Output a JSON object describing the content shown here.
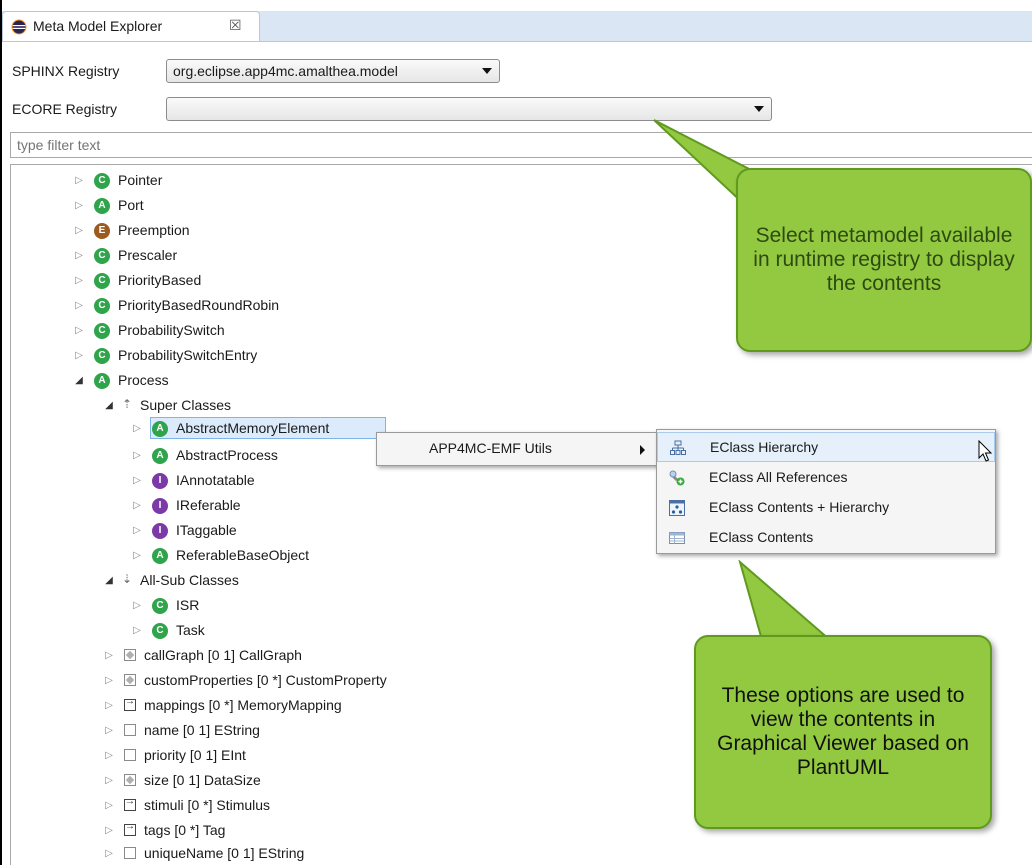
{
  "tab": {
    "title": "Meta Model Explorer",
    "close": "☒"
  },
  "sphinx": {
    "label": "SPHINX Registry",
    "value": "org.eclipse.app4mc.amalthea.model"
  },
  "ecore": {
    "label": "ECORE Registry",
    "value": ""
  },
  "filter": {
    "placeholder": "type filter text"
  },
  "tree": {
    "top_items": [
      {
        "kind": "C",
        "label": "Pointer"
      },
      {
        "kind": "A",
        "label": "Port"
      },
      {
        "kind": "E",
        "label": "Preemption"
      },
      {
        "kind": "C",
        "label": "Prescaler"
      },
      {
        "kind": "C",
        "label": "PriorityBased"
      },
      {
        "kind": "C",
        "label": "PriorityBasedRoundRobin"
      },
      {
        "kind": "C",
        "label": "ProbabilitySwitch"
      },
      {
        "kind": "C",
        "label": "ProbabilitySwitchEntry"
      },
      {
        "kind": "A",
        "label": "Process"
      }
    ],
    "super_group": "Super Classes",
    "super_items": [
      {
        "kind": "A",
        "label": "AbstractMemoryElement"
      },
      {
        "kind": "A",
        "label": "AbstractProcess"
      },
      {
        "kind": "I",
        "label": "IAnnotatable"
      },
      {
        "kind": "I",
        "label": "IReferable"
      },
      {
        "kind": "I",
        "label": "ITaggable"
      },
      {
        "kind": "A",
        "label": "ReferableBaseObject"
      }
    ],
    "sub_group": "All-Sub Classes",
    "sub_items": [
      {
        "kind": "C",
        "label": "ISR"
      },
      {
        "kind": "C",
        "label": "Task"
      }
    ],
    "features": [
      {
        "icon": "containment",
        "label": "callGraph  [0 1] CallGraph"
      },
      {
        "icon": "containment",
        "label": "customProperties  [0 *] CustomProperty"
      },
      {
        "icon": "reference",
        "label": "mappings  [0 *] MemoryMapping"
      },
      {
        "icon": "attribute",
        "label": "name  [0 1] EString"
      },
      {
        "icon": "attribute",
        "label": "priority  [0 1] EInt"
      },
      {
        "icon": "containment",
        "label": "size  [0 1] DataSize"
      },
      {
        "icon": "reference",
        "label": "stimuli  [0 *] Stimulus"
      },
      {
        "icon": "reference",
        "label": "tags  [0 *] Tag"
      },
      {
        "icon": "attribute",
        "label": "uniqueName  [0 1] EString"
      }
    ]
  },
  "context_menu": {
    "item": "APP4MC-EMF Utils"
  },
  "submenu": {
    "items": [
      {
        "icon": "hierarchy-icon",
        "label": "EClass Hierarchy"
      },
      {
        "icon": "references-icon",
        "label": "EClass All References"
      },
      {
        "icon": "contents-hierarchy-icon",
        "label": "EClass Contents + Hierarchy"
      },
      {
        "icon": "contents-table-icon",
        "label": "EClass Contents"
      }
    ]
  },
  "callouts": {
    "registry": "Select metamodel available in runtime registry to display the contents",
    "options": "These options are used to view the contents in Graphical Viewer based on PlantUML"
  },
  "colors": {
    "callout_fill": "#93c940",
    "class_badge": "#2fa44a",
    "enum_badge": "#9c5a1e",
    "interface_badge": "#7b3aa8",
    "selection": "#dcebfb"
  }
}
